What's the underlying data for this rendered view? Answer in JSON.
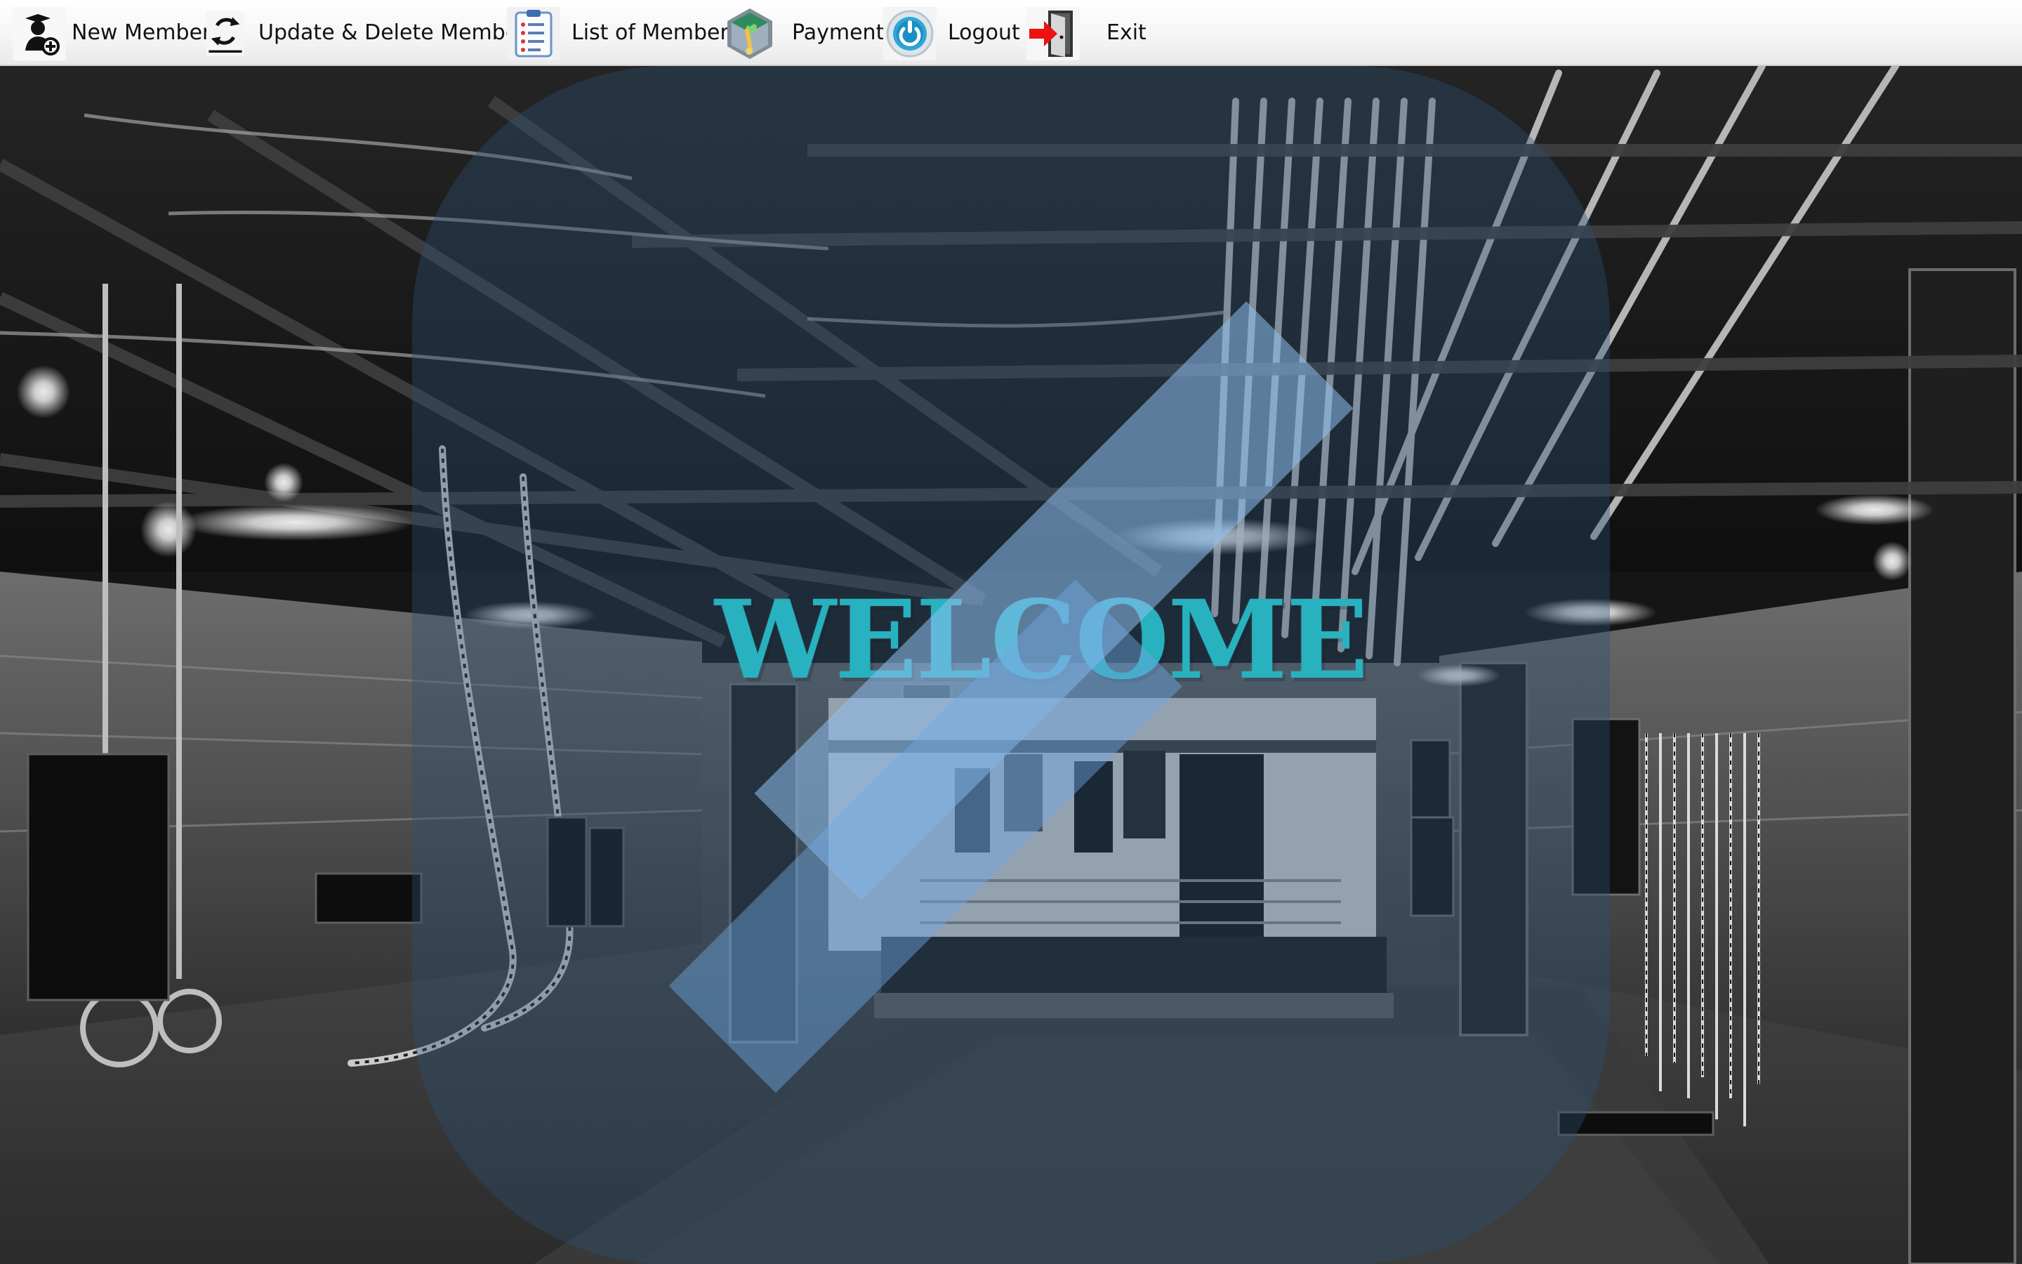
{
  "menu": {
    "items": [
      {
        "label": "New Member",
        "icon": "add-member-icon"
      },
      {
        "label": "Update & Delete Member",
        "icon": "refresh-icon"
      },
      {
        "label": "List of Member",
        "icon": "clipboard-list-icon"
      },
      {
        "label": "Payment",
        "icon": "payment-icon"
      },
      {
        "label": "Logout",
        "icon": "power-icon"
      },
      {
        "label": "Exit",
        "icon": "exit-door-icon"
      }
    ]
  },
  "hero": {
    "welcome_text": "WELCOME"
  },
  "colors": {
    "welcome": "#26eeee",
    "menubar_top": "#ffffff",
    "menubar_bottom": "#e9e9e9"
  }
}
